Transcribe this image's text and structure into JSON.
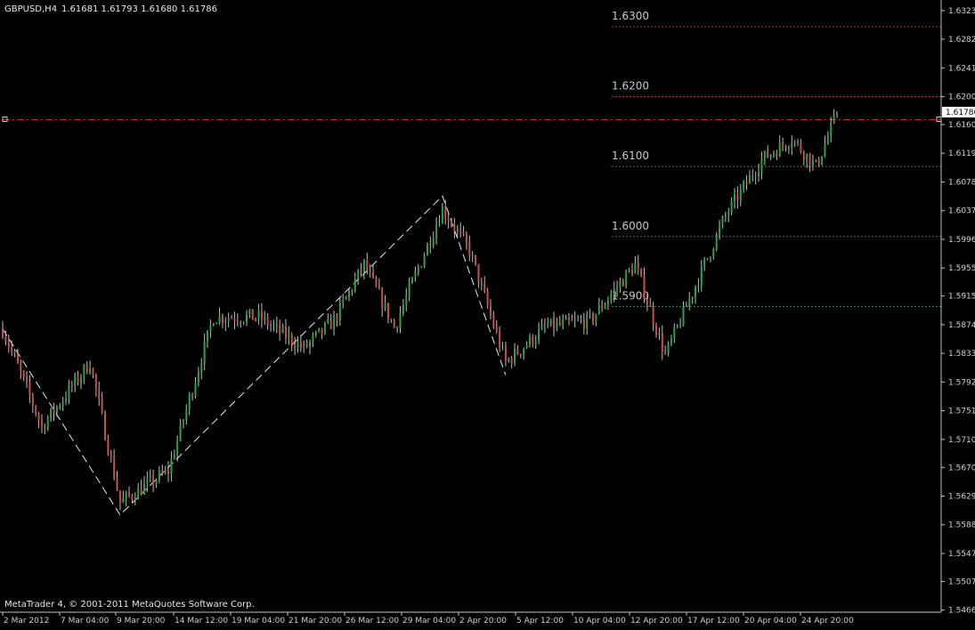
{
  "header": {
    "symbol": "GBPUSD,H4",
    "ohlc": "1.61681 1.61793 1.61680 1.61786"
  },
  "copyright": "MetaTrader 4, © 2001-2011 MetaQuotes Software Corp.",
  "colors": {
    "background": "#000000",
    "axis": "#c0c0c0",
    "bull": "#2f9e44",
    "bear": "#c0504d",
    "wick": "#bdbdbd",
    "level_red": "#b23a3a",
    "level_green": "#2f8f3a",
    "bid_line": "#b23a3a",
    "price_label_bg": "#ffffff"
  },
  "chart_data": {
    "type": "candlestick",
    "symbol": "GBPUSD",
    "timeframe": "H4",
    "ylim": [
      1.5463,
      1.6333
    ],
    "y_ticks": [
      "1.63230",
      "1.62820",
      "1.62410",
      "1.62000",
      "1.61600",
      "1.61190",
      "1.60780",
      "1.60370",
      "1.59960",
      "1.59550",
      "1.59150",
      "1.58740",
      "1.58330",
      "1.57920",
      "1.57510",
      "1.57100",
      "1.56700",
      "1.56290",
      "1.55880",
      "1.55470",
      "1.55070",
      "1.54660"
    ],
    "x_ticks": [
      "2 Mar 2012",
      "7 Mar 04:00",
      "9 Mar 20:00",
      "14 Mar 12:00",
      "19 Mar 04:00",
      "21 Mar 20:00",
      "26 Mar 12:00",
      "29 Mar 04:00",
      "2 Apr 20:00",
      "5 Apr 12:00",
      "10 Apr 04:00",
      "12 Apr 20:00",
      "17 Apr 12:00",
      "20 Apr 04:00",
      "24 Apr 20:00"
    ],
    "current_price": "1.61786",
    "bid_line_value": 1.6167,
    "levels": [
      {
        "label": "1.6300",
        "value": 1.63,
        "color": "red"
      },
      {
        "label": "1.6200",
        "value": 1.62,
        "color": "red"
      },
      {
        "label": "1.6100",
        "value": 1.61,
        "color": "green"
      },
      {
        "label": "1.6000",
        "value": 1.6,
        "color": "green"
      },
      {
        "label": "1.5900",
        "value": 1.59,
        "color": "green"
      }
    ],
    "zigzag": [
      {
        "bar": 0,
        "price": 1.5868
      },
      {
        "bar": 39,
        "price": 1.5602
      },
      {
        "bar": 146,
        "price": 1.6058
      },
      {
        "bar": 167,
        "price": 1.5802
      }
    ],
    "anchors": [
      {
        "bar": 0,
        "price": 1.5868
      },
      {
        "bar": 13,
        "price": 1.5728
      },
      {
        "bar": 29,
        "price": 1.582
      },
      {
        "bar": 39,
        "price": 1.562
      },
      {
        "bar": 55,
        "price": 1.5665
      },
      {
        "bar": 70,
        "price": 1.5885
      },
      {
        "bar": 85,
        "price": 1.5885
      },
      {
        "bar": 100,
        "price": 1.584
      },
      {
        "bar": 110,
        "price": 1.588
      },
      {
        "bar": 120,
        "price": 1.596
      },
      {
        "bar": 130,
        "price": 1.587
      },
      {
        "bar": 146,
        "price": 1.604
      },
      {
        "bar": 155,
        "price": 1.598
      },
      {
        "bar": 167,
        "price": 1.582
      },
      {
        "bar": 180,
        "price": 1.587
      },
      {
        "bar": 195,
        "price": 1.588
      },
      {
        "bar": 210,
        "price": 1.596
      },
      {
        "bar": 220,
        "price": 1.583
      },
      {
        "bar": 230,
        "price": 1.593
      },
      {
        "bar": 240,
        "price": 1.603
      },
      {
        "bar": 252,
        "price": 1.611
      },
      {
        "bar": 262,
        "price": 1.614
      },
      {
        "bar": 270,
        "price": 1.61
      },
      {
        "bar": 277,
        "price": 1.6175
      }
    ],
    "bar_count": 278
  }
}
